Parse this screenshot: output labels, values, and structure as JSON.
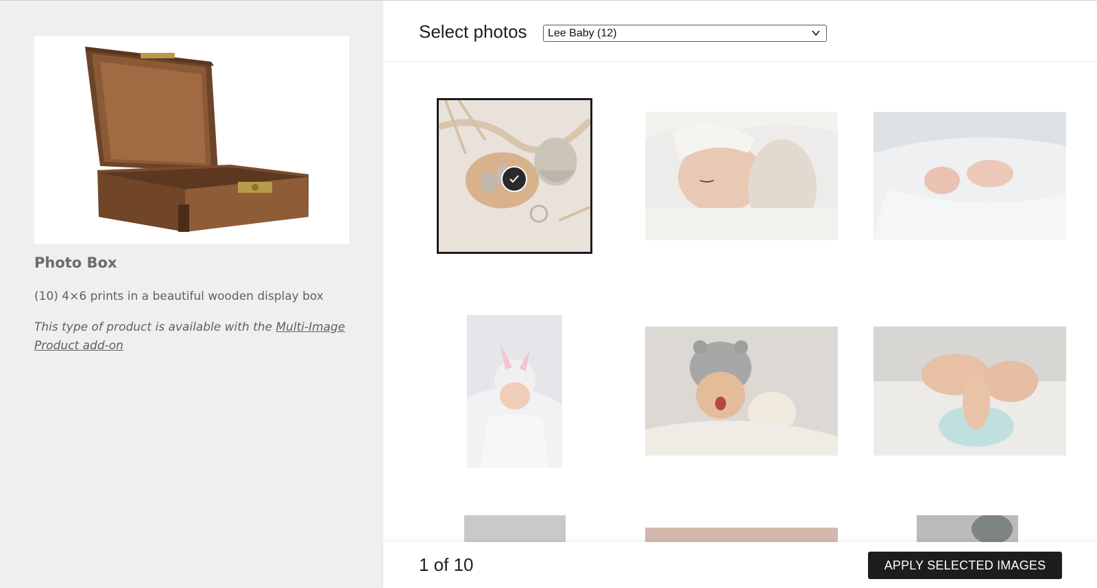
{
  "product": {
    "title": "Photo Box",
    "description": "(10) 4×6 prints in a beautiful wooden display box",
    "note_prefix": "This type of product is available with the ",
    "note_link": "Multi-Image Product add-on"
  },
  "picker": {
    "title": "Select photos",
    "album_selected": "Lee Baby (12)"
  },
  "photos": [
    {
      "subject": "knit baby booties and bonnet on blanket",
      "selected": true
    },
    {
      "subject": "sleeping baby on white pillow",
      "selected": false
    },
    {
      "subject": "baby feet under white blanket",
      "selected": false
    },
    {
      "subject": "baby in bunny ear hat on white blanket",
      "selected": false
    },
    {
      "subject": "yawning baby in grey bear hat with teddy",
      "selected": false
    },
    {
      "subject": "baby legs in blue diaper",
      "selected": false
    },
    {
      "subject": "baby photo",
      "selected": false
    },
    {
      "subject": "baby photo",
      "selected": false
    },
    {
      "subject": "baby photo",
      "selected": false
    }
  ],
  "footer": {
    "counter": "1 of 10",
    "apply_label": "APPLY SELECTED IMAGES"
  },
  "colors": {
    "panel_bg": "#efefef",
    "button_bg": "#1d1d1d",
    "selected_border": "#1b1b1b"
  }
}
